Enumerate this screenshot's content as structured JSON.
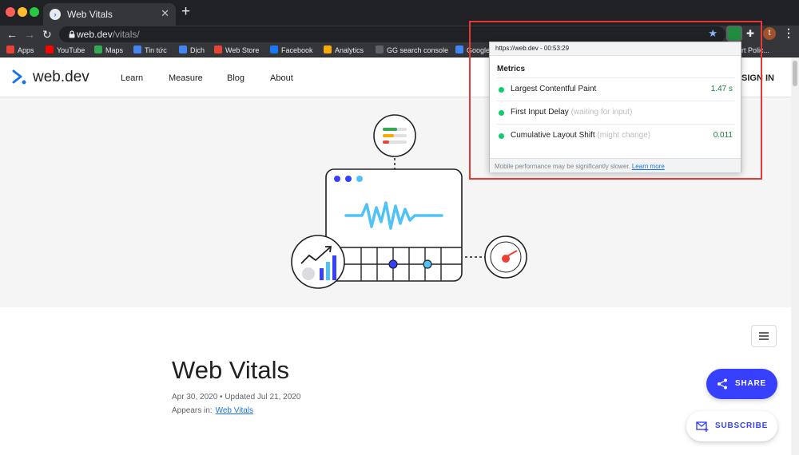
{
  "browser": {
    "tab_title": "Web Vitals",
    "tab_close": "✕",
    "new_tab": "+",
    "url_host": "web.dev",
    "url_path": "/vitals/",
    "avatar_letter": "t"
  },
  "bookmarks": [
    {
      "label": "Apps",
      "color": "#ea4335"
    },
    {
      "label": "YouTube",
      "color": "#ff0000"
    },
    {
      "label": "Maps",
      "color": "#34a853"
    },
    {
      "label": "Tin tức",
      "color": "#4285f4"
    },
    {
      "label": "Dịch",
      "color": "#4285f4"
    },
    {
      "label": "Web Store",
      "color": "#ea4335"
    },
    {
      "label": "Facebook",
      "color": "#1877f2"
    },
    {
      "label": "Analytics",
      "color": "#f9ab00"
    },
    {
      "label": "GG search console",
      "color": "#5f6368"
    },
    {
      "label": "Google",
      "color": "#4285f4"
    },
    {
      "label": "rt Polic...",
      "color": "#9aa0a6"
    }
  ],
  "site": {
    "logo": "web.dev",
    "nav": [
      "Learn",
      "Measure",
      "Blog",
      "About"
    ],
    "signin": "SIGN IN"
  },
  "article": {
    "title": "Web Vitals",
    "meta": "Apr 30, 2020  •  Updated Jul 21, 2020",
    "appears_in_label": "Appears in:",
    "appears_in_link": "Web Vitals"
  },
  "actions": {
    "share": "SHARE",
    "subscribe": "SUBSCRIBE"
  },
  "popup": {
    "header": "https://web.dev - 00:53:29",
    "title": "Metrics",
    "metrics": [
      {
        "name": "Largest Contentful Paint",
        "note": "",
        "value": "1.47 s"
      },
      {
        "name": "First Input Delay",
        "note": "(waiting for input)",
        "value": ""
      },
      {
        "name": "Cumulative Layout Shift",
        "note": "(might change)",
        "value": "0.011"
      }
    ],
    "footer_text": "Mobile performance may be significantly slower.",
    "footer_link": "Learn more"
  },
  "colors": {
    "accent": "#3740ff",
    "good": "#0cce6b",
    "annotation": "#e53935"
  }
}
